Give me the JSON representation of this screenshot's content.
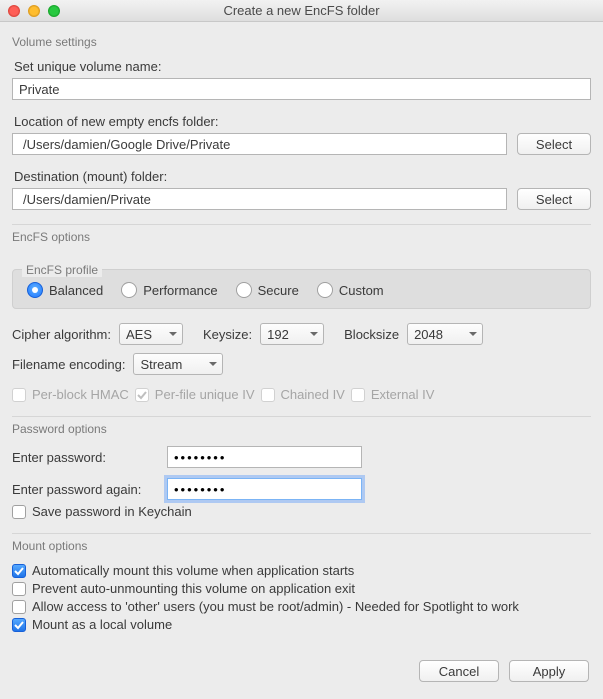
{
  "window": {
    "title": "Create a new EncFS folder"
  },
  "volume": {
    "group_label": "Volume settings",
    "name_label": "Set unique volume name:",
    "name_value": "Private",
    "location_label": "Location of new empty encfs folder:",
    "location_value": "/Users/damien/Google Drive/Private",
    "dest_label": "Destination (mount) folder:",
    "dest_value": "/Users/damien/Private",
    "select_btn": "Select"
  },
  "encfs": {
    "group_label": "EncFS options",
    "profile_label": "EncFS profile",
    "profiles": {
      "balanced": "Balanced",
      "performance": "Performance",
      "secure": "Secure",
      "custom": "Custom"
    },
    "cipher_label": "Cipher algorithm:",
    "cipher_value": "AES",
    "keysize_label": "Keysize:",
    "keysize_value": "192",
    "blocksize_label": "Blocksize",
    "blocksize_value": "2048",
    "filename_enc_label": "Filename encoding:",
    "filename_enc_value": "Stream",
    "hmac_label": "Per-block HMAC",
    "per_file_iv_label": "Per-file unique IV",
    "chained_iv_label": "Chained IV",
    "external_iv_label": "External IV"
  },
  "password": {
    "group_label": "Password options",
    "enter_label": "Enter password:",
    "enter_value": "••••••••",
    "again_label": "Enter password again:",
    "again_value": "••••••••",
    "keychain_label": "Save password in Keychain"
  },
  "mount": {
    "group_label": "Mount options",
    "auto_mount": "Automatically mount this volume when application starts",
    "prevent_unmount": "Prevent auto-unmounting this volume on application exit",
    "allow_other": "Allow access to 'other' users (you must be root/admin) - Needed for Spotlight to work",
    "local_volume": "Mount as a local volume"
  },
  "buttons": {
    "cancel": "Cancel",
    "apply": "Apply"
  }
}
